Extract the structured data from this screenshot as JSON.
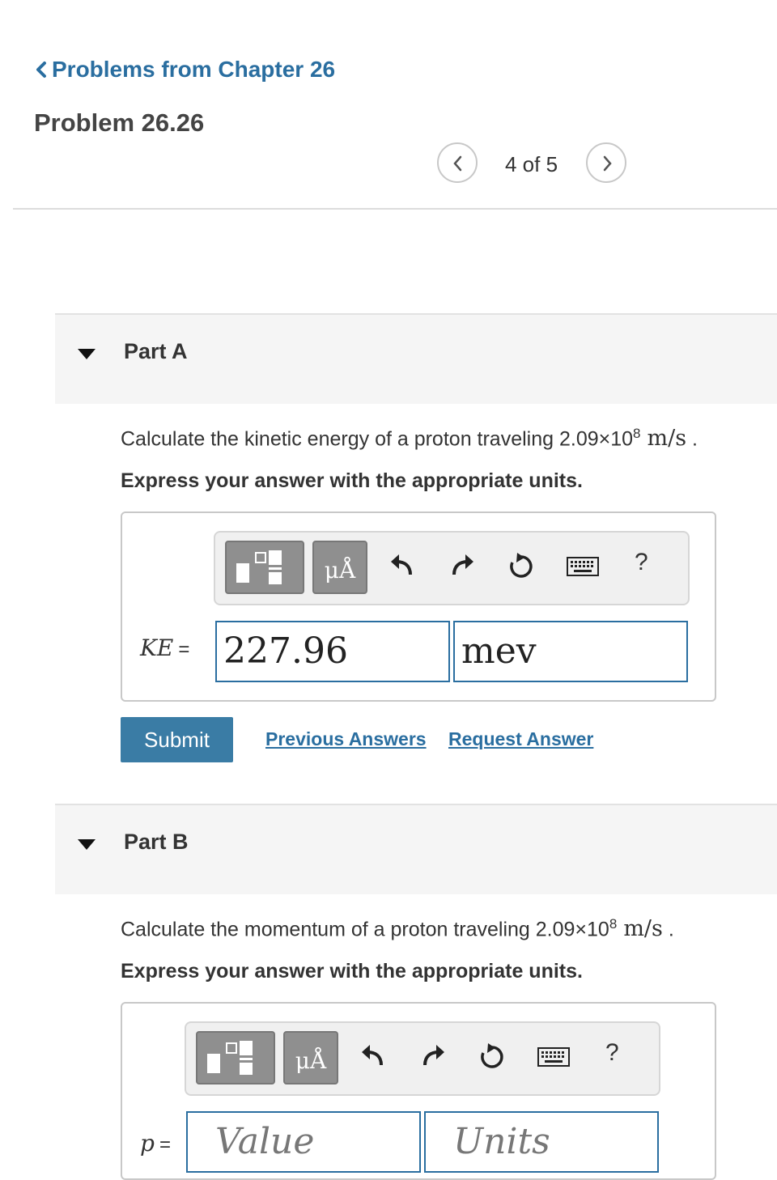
{
  "nav": {
    "back_link": "Problems from Chapter 26",
    "problem_title": "Problem 26.26",
    "pager_label": "4 of 5"
  },
  "part_a": {
    "title": "Part A",
    "question": "Calculate the kinetic energy of a proton traveling 2.09×10",
    "exponent": "8",
    "unit": "m/s",
    "period": ".",
    "instruction": "Express your answer with the appropriate units.",
    "toolbar": {
      "symbol_label": "μÅ",
      "help_label": "?"
    },
    "variable": "KE",
    "equals": "=",
    "value": "227.96",
    "units": "mev",
    "submit_label": "Submit",
    "previous_answers_label": "Previous Answers",
    "request_answer_label": "Request Answer"
  },
  "part_b": {
    "title": "Part B",
    "question": "Calculate the momentum of a proton traveling 2.09×10",
    "exponent": "8",
    "unit": "m/s",
    "period": ".",
    "instruction": "Express your answer with the appropriate units.",
    "toolbar": {
      "symbol_label": "μÅ",
      "help_label": "?"
    },
    "variable": "p",
    "equals": "=",
    "value_placeholder": "Value",
    "units_placeholder": "Units"
  },
  "colors": {
    "link": "#2a6ea0",
    "submit_bg": "#3a7ca5",
    "field_border": "#2a6ea0",
    "part_header_bg": "#f5f5f5"
  }
}
